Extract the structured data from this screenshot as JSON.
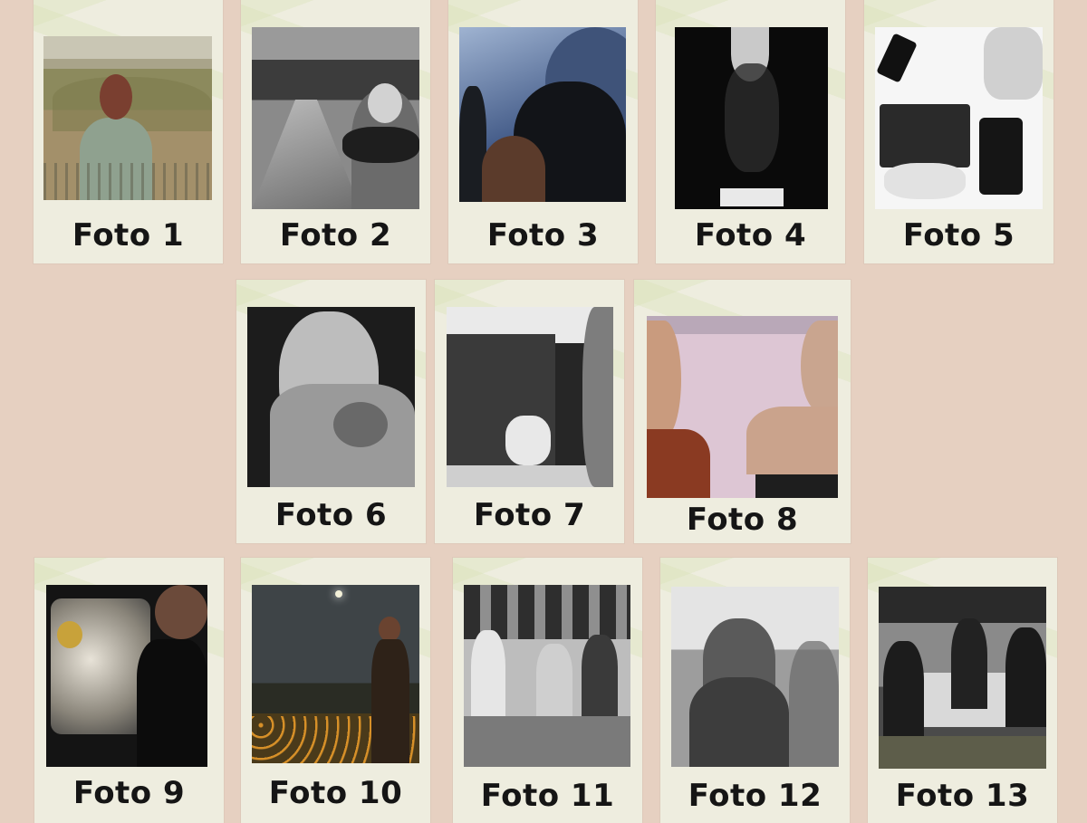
{
  "cards": [
    {
      "caption": "Foto 1"
    },
    {
      "caption": "Foto 2"
    },
    {
      "caption": "Foto 3"
    },
    {
      "caption": "Foto 4"
    },
    {
      "caption": "Foto 5"
    },
    {
      "caption": "Foto 6"
    },
    {
      "caption": "Foto 7"
    },
    {
      "caption": "Foto 8"
    },
    {
      "caption": "Foto 9"
    },
    {
      "caption": "Foto 10"
    },
    {
      "caption": "Foto 11"
    },
    {
      "caption": "Foto 12"
    },
    {
      "caption": "Foto 13"
    }
  ],
  "colors": {
    "background": "#e6d0c1",
    "card": "#eeeddf",
    "caption": "#151515"
  }
}
